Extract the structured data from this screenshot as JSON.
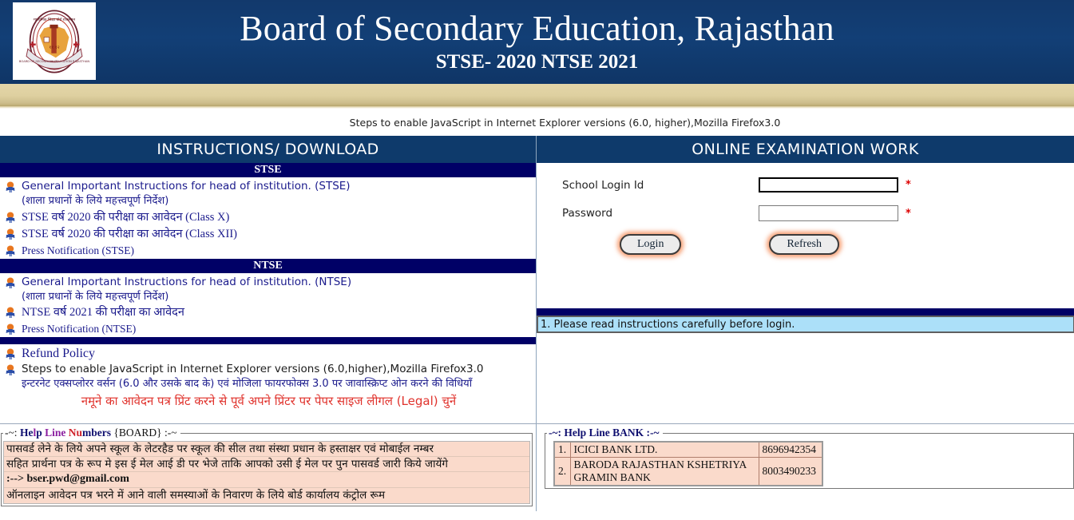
{
  "header": {
    "logo_icon": "bser-emblem-icon",
    "title": "Board of Secondary Education, Rajasthan",
    "subtitle": "STSE- 2020 NTSE 2021",
    "bg_color": "#123d72"
  },
  "js_note": "Steps to enable JavaScript in Internet Explorer versions (6.0, higher),Mozilla Firefox3.0",
  "left_panel": {
    "heading": "INSTRUCTIONS/ DOWNLOAD",
    "sections": [
      {
        "bar_label": "STSE",
        "items": [
          {
            "icon": "new-bullet-icon",
            "text": "General Important Instructions for head of institution. (STSE)",
            "text_hindi": "(शाला प्रधानों के लिये महत्त्वपूर्ण निर्देश)"
          },
          {
            "icon": "new-bullet-icon",
            "text": "STSE वर्ष 2020 की परीक्षा का आवेदन (Class X)"
          },
          {
            "icon": "new-bullet-icon",
            "text": "STSE वर्ष 2020 की परीक्षा का आवेदन (Class XII)"
          },
          {
            "icon": "new-bullet-icon",
            "text": "Press Notification (STSE)"
          }
        ]
      },
      {
        "bar_label": "NTSE",
        "items": [
          {
            "icon": "new-bullet-icon",
            "text": "General Important Instructions for head of institution. (NTSE)",
            "text_hindi": "(शाला प्रधानों के लिये महत्त्वपूर्ण निर्देश)"
          },
          {
            "icon": "new-bullet-icon",
            "text": "NTSE वर्ष 2021 की परीक्षा का आवेदन"
          },
          {
            "icon": "new-bullet-icon",
            "text": "Press Notification (NTSE)"
          }
        ]
      }
    ],
    "refund": {
      "title": "Refund Policy",
      "js_steps": "Steps to enable JavaScript in Internet Explorer versions (6.0,higher),Mozilla Firefox3.0",
      "js_steps_hindi": "इन्टरनेट एक्सप्लोरर वर्सन (6.0 और उसके बाद के) एवं मोजिला फायरफोक्स 3.0 पर जावास्क्रिप्ट ओन करने की विधियाँ",
      "red_note": "नमूने का आवेदन पत्र प्रिंट करने से पूर्व अपने प्रिंटर पर पेपर साइज लीगल (Legal) चुनें",
      "red_note_color": "#e0322c"
    }
  },
  "right_panel": {
    "heading": "ONLINE EXAMINATION WORK",
    "form": {
      "login_id_label": "School Login Id",
      "login_id_value": "",
      "login_id_required": "*",
      "password_label": "Password",
      "password_value": "",
      "password_required": "*",
      "login_button": "Login",
      "refresh_button": "Refresh"
    },
    "notice": "1. Please read instructions carefully before login.",
    "notice_bg": "#ace0f9"
  },
  "help_board": {
    "legend_parts": [
      {
        "t": "-~: ",
        "c": "k"
      },
      {
        "t": "He",
        "c": "n"
      },
      {
        "t": "l",
        "c": "p"
      },
      {
        "t": "p ",
        "c": "n"
      },
      {
        "t": "Line",
        "c": "p"
      },
      {
        "t": " ",
        "c": "k"
      },
      {
        "t": "Nu",
        "c": "r"
      },
      {
        "t": "mbers",
        "c": "n"
      },
      {
        "t": " {BOARD} :-~",
        "c": "k"
      }
    ],
    "lines": [
      "पासवर्ड लेने के लिये अपने स्कूल के लेटरहैड पर स्कूल की सील तथा संस्था प्रधान के हस्ताक्षर एवं मोबाईल नम्बर",
      "सहित प्रार्थना पत्र के रूप मे इस ई मेल आई डी पर भेजे ताकि आपको उसी ई मेल पर पुन पासवर्ड जारी किये जायेंगे",
      ":--> bser.pwd@gmail.com",
      "ऑनलाइन आवेदन पत्र भरने में आने वाली समस्याओं के निवारण के लिये बोर्ड कार्यालय कंट्रोल रूम"
    ],
    "bg_color": "#fadacb"
  },
  "help_bank": {
    "legend": "-~: Help Line BANK :-~",
    "rows": [
      {
        "index": "1.",
        "name": "ICICI BANK LTD.",
        "phone": "8696942354"
      },
      {
        "index": "2.",
        "name": "BARODA RAJASTHAN KSHETRIYA GRAMIN BANK",
        "phone": "8003490233"
      }
    ],
    "bg_color": "#fadacb"
  }
}
